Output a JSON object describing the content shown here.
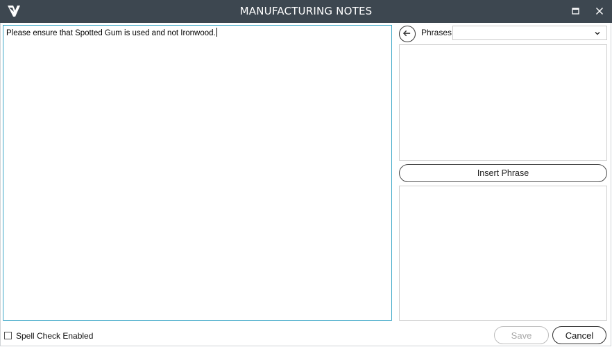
{
  "window": {
    "title": "MANUFACTURING NOTES",
    "logo_icon": "v-logo-icon",
    "maximize_icon": "maximize-icon",
    "close_icon": "close-icon",
    "titlebar_color": "#3d4750"
  },
  "notes": {
    "text": "Please ensure that Spotted Gum is used and not Ironwood.",
    "focus_border_color": "#3aa6c6"
  },
  "phrases": {
    "back_icon": "arrow-left-circle-icon",
    "label": "Phrases:",
    "selected_value": "",
    "dropdown_icon": "chevron-down-icon",
    "insert_label": "Insert Phrase"
  },
  "footer": {
    "spell_check_label": "Spell Check Enabled",
    "spell_check_checked": false,
    "save_label": "Save",
    "save_enabled": false,
    "cancel_label": "Cancel"
  }
}
